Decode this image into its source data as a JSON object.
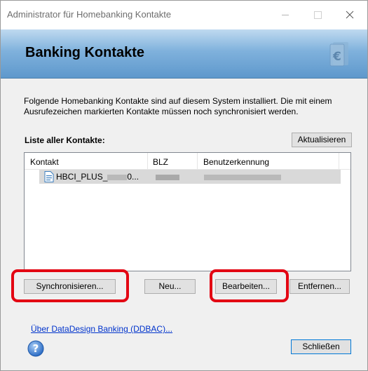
{
  "window": {
    "title": "Administrator für Homebanking Kontakte",
    "controls": [
      "minimize-icon",
      "maximize-icon",
      "close-icon"
    ]
  },
  "banner": {
    "heading": "Banking Kontakte",
    "logo_icon": "euro-document-icon"
  },
  "intro_text": "Folgende Homebanking Kontakte sind auf diesem System installiert. Die mit einem Ausrufezeichen markierten Kontakte müssen noch synchronisiert werden.",
  "list": {
    "label": "Liste aller Kontakte:",
    "refresh_label": "Aktualisieren",
    "columns": [
      "Kontakt",
      "BLZ",
      "Benutzerkennung"
    ],
    "rows": [
      {
        "kontakt_prefix": "HBCI_PLUS_",
        "kontakt_suffix": "0...",
        "icon": "contact-file-icon"
      }
    ]
  },
  "actions": {
    "sync_label": "Synchronisieren...",
    "new_label": "Neu...",
    "edit_label": "Bearbeiten...",
    "remove_label": "Entfernen..."
  },
  "about_link": "Über DataDesign Banking (DDBAC)...",
  "close_label": "Schließen",
  "colors": {
    "highlight": "#e30613",
    "link": "#0033cc",
    "banner_top": "#bfdaf0",
    "banner_bottom": "#5e98cc"
  }
}
